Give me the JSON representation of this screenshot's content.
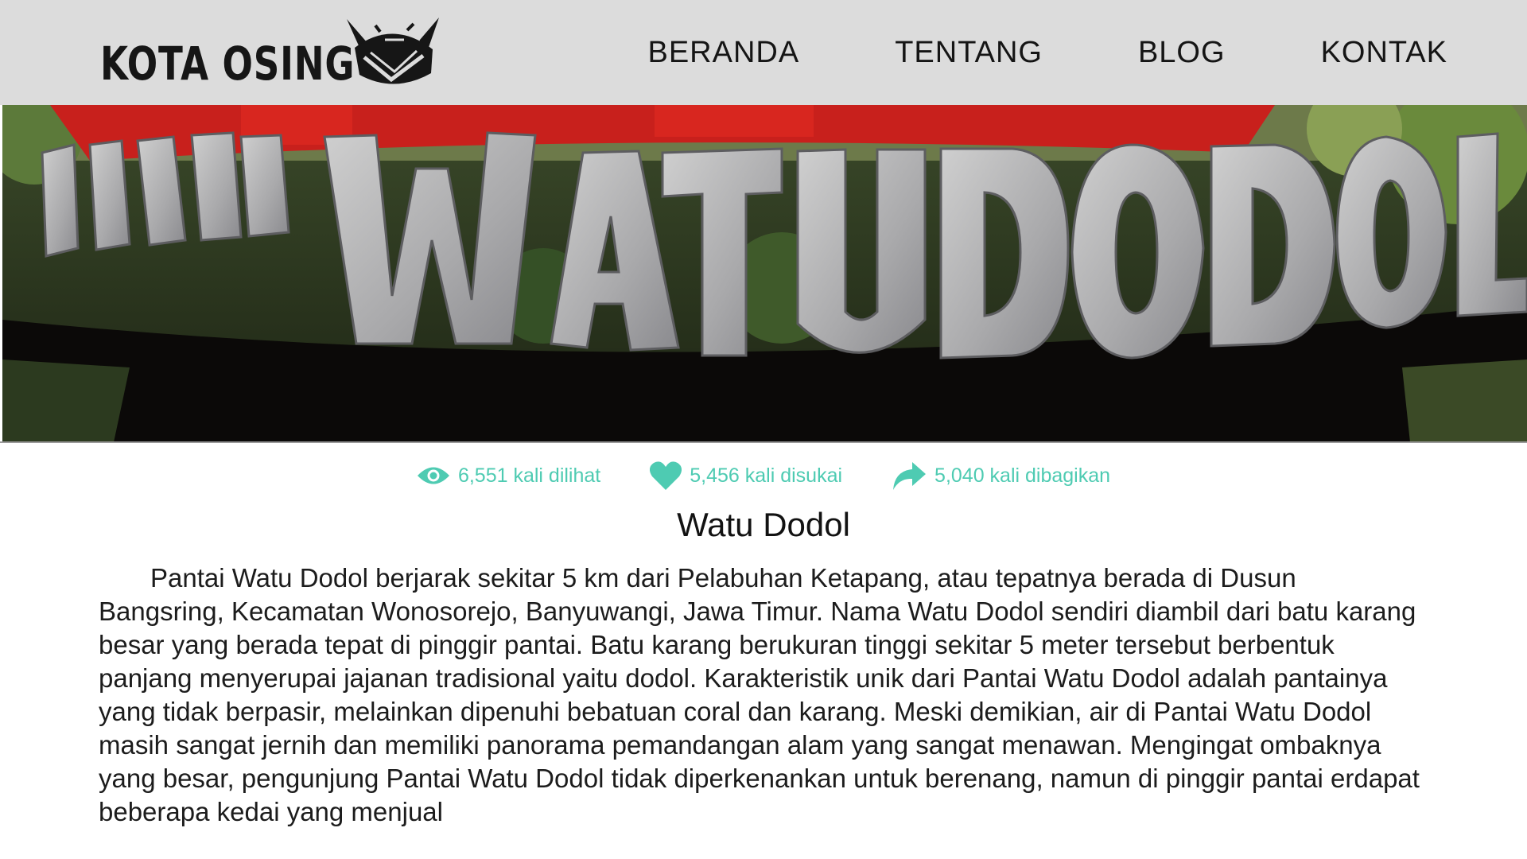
{
  "header": {
    "logo_text": "KOTA OSING",
    "nav": [
      {
        "label": "BERANDA"
      },
      {
        "label": "TENTANG"
      },
      {
        "label": "BLOG"
      },
      {
        "label": "KONTAK"
      }
    ]
  },
  "banner": {
    "sign_text": "GRAND WATUDODOL"
  },
  "stats": {
    "views": "6,551 kali dilihat",
    "likes": "5,456 kali disukai",
    "shares": "5,040 kali dibagikan"
  },
  "article": {
    "title": "Watu Dodol",
    "body": "Pantai Watu Dodol berjarak sekitar 5 km dari Pelabuhan Ketapang, atau tepatnya berada di Dusun Bangsring, Kecamatan Wonosorejo, Banyuwangi, Jawa Timur. Nama Watu Dodol sendiri diambil dari batu karang besar yang berada tepat di pinggir pantai. Batu karang berukuran tinggi sekitar 5 meter tersebut berbentuk panjang menyerupai jajanan tradisional yaitu dodol. Karakteristik unik dari Pantai Watu Dodol adalah pantainya yang tidak berpasir, melainkan dipenuhi bebatuan coral dan karang. Meski demikian, air di Pantai Watu Dodol masih sangat jernih dan memiliki panorama pemandangan alam yang sangat menawan. Mengingat ombaknya yang besar, pengunjung Pantai Watu Dodol tidak diperkenankan untuk berenang, namun di pinggir pantai erdapat beberapa kedai yang menjual"
  },
  "colors": {
    "accent": "#4ecbb2",
    "header_bg": "#dcdcdc"
  },
  "icons": {
    "views": "eye-icon",
    "likes": "heart-icon",
    "shares": "share-arrow-icon"
  }
}
